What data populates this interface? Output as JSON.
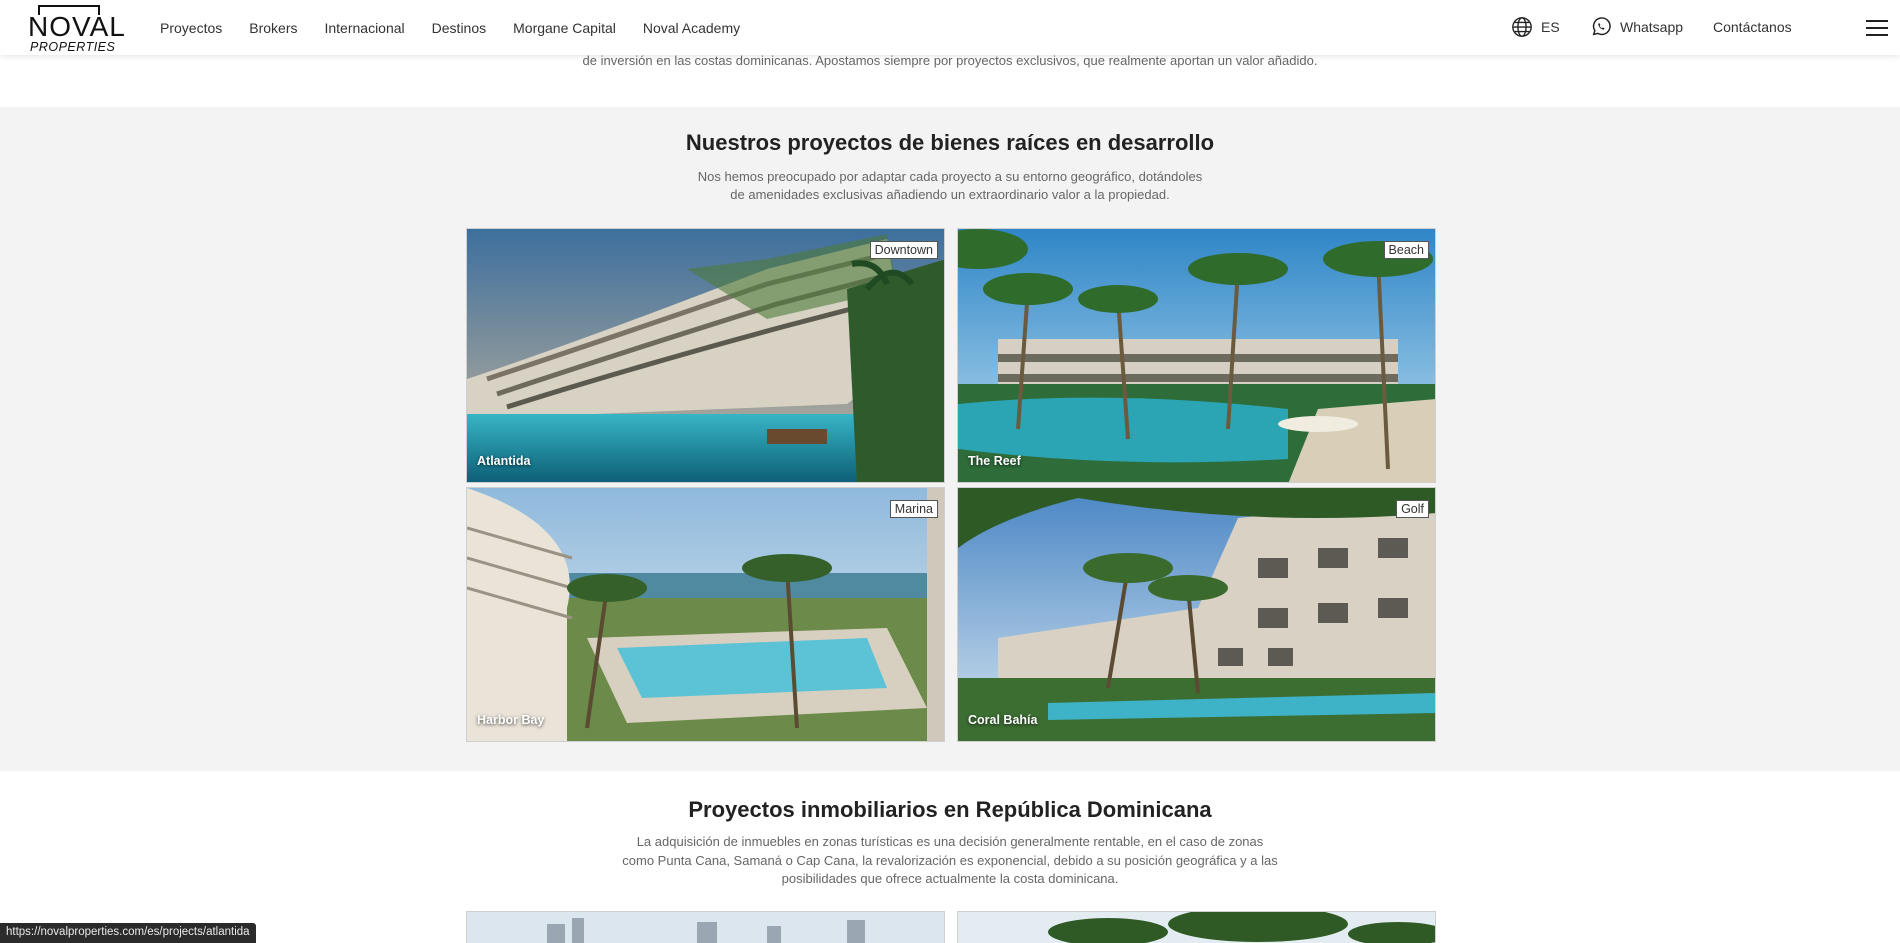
{
  "header": {
    "logo": {
      "word": "NOVAL",
      "sub": "PROPERTIES"
    },
    "nav": [
      "Proyectos",
      "Brokers",
      "Internacional",
      "Destinos",
      "Morgane Capital",
      "Noval Academy"
    ],
    "language": "ES",
    "whatsapp": "Whatsapp",
    "contact": "Contáctanos"
  },
  "intro": {
    "text": "de inversión en las costas dominicanas. Apostamos siempre por proyectos exclusivos, que realmente aportan un valor añadido."
  },
  "projects_section": {
    "title": "Nuestros proyectos de bienes raíces en desarrollo",
    "subtitle_line1": "Nos hemos preocupado por adaptar cada proyecto a su entorno geográfico, dotándoles",
    "subtitle_line2": "de amenidades exclusivas añadiendo un extraordinario valor a la propiedad.",
    "cards": [
      {
        "name": "Atlantida",
        "tag": "Downtown"
      },
      {
        "name": "The Reef",
        "tag": "Beach"
      },
      {
        "name": "Harbor Bay",
        "tag": "Marina"
      },
      {
        "name": "Coral Bahía",
        "tag": "Golf"
      }
    ]
  },
  "dominicana_section": {
    "title": "Proyectos inmobiliarios en República Dominicana",
    "line1": "La adquisición de inmuebles en zonas turísticas es una decisión generalmente rentable, en el caso de zonas",
    "line2": "como Punta Cana, Samaná o Cap Cana, la revalorización es exponencial, debido a su posición geográfica y a las",
    "line3": "posibilidades que ofrece actualmente la costa dominicana."
  },
  "status_bar": {
    "url": "https://novalproperties.com/es/projects/atlantida"
  },
  "colors": {
    "section_bg": "#f3f3f3",
    "text_dark": "#222222",
    "text_muted": "#666666"
  },
  "icons": [
    "globe-icon",
    "whatsapp-icon",
    "menu-icon"
  ]
}
